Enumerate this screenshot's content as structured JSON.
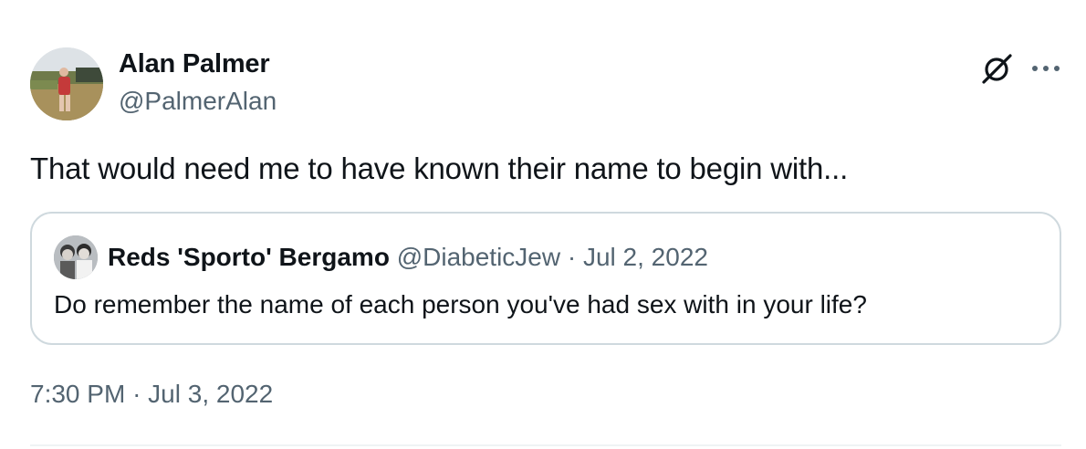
{
  "author": {
    "name": "Alan Palmer",
    "handle": "@PalmerAlan"
  },
  "tweet": {
    "text": "That would need me to have known their name to begin with..."
  },
  "quoted_tweet": {
    "name": "Reds 'Sporto' Bergamo",
    "handle": "@DiabeticJew",
    "separator": "·",
    "date": "Jul 2, 2022",
    "text": "Do remember the name of each person you've had sex with in your life?"
  },
  "meta": {
    "time": "7:30 PM",
    "separator": "·",
    "date": "Jul 3, 2022"
  },
  "icons": {
    "grok": "grok-icon",
    "more": "more-icon"
  },
  "colors": {
    "text_primary": "#0f1419",
    "text_secondary": "#536471",
    "border": "#cfd9de"
  }
}
